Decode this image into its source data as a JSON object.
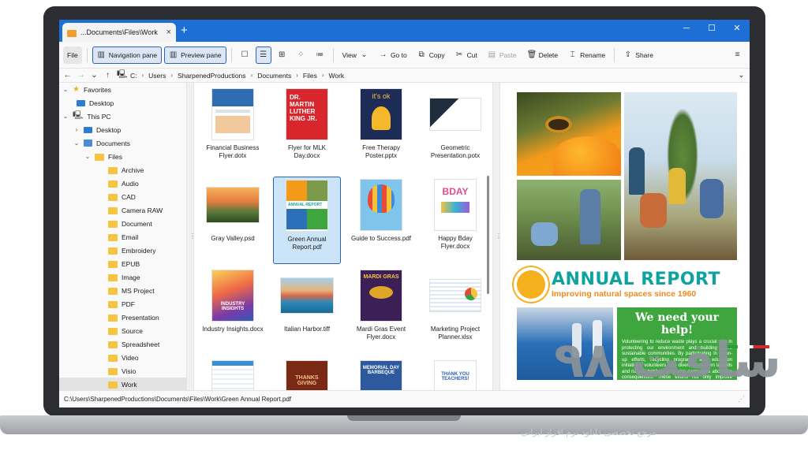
{
  "window": {
    "tab_title": "...Documents\\Files\\Work",
    "new_tab": "+",
    "close_tab": "×",
    "minimize": "─",
    "maximize": "☐",
    "close": "✕"
  },
  "toolbar": {
    "file": "File",
    "navigation_pane": "Navigation pane",
    "preview_pane": "Preview pane",
    "view": "View",
    "go_to": "Go to",
    "copy": "Copy",
    "cut": "Cut",
    "paste": "Paste",
    "delete": "Delete",
    "rename": "Rename",
    "share": "Share"
  },
  "address": {
    "crumbs": [
      "C:",
      "Users",
      "SharpenedProductions",
      "Documents",
      "Files",
      "Work"
    ]
  },
  "sidebar": {
    "favorites": "Favorites",
    "fav_desktop": "Desktop",
    "this_pc": "This PC",
    "desktop": "Desktop",
    "documents": "Documents",
    "files": "Files",
    "folders": [
      "Archive",
      "Audio",
      "CAD",
      "Camera RAW",
      "Document",
      "Email",
      "Embroidery",
      "EPUB",
      "Image",
      "MS Project",
      "PDF",
      "Presentation",
      "Source",
      "Spreadsheet",
      "Video",
      "Visio",
      "Work"
    ]
  },
  "files": [
    {
      "name": "Financial Business Flyer.dotx",
      "thumb": "flyer-blue"
    },
    {
      "name": "Flyer for MLK Day.docx",
      "thumb": "mlk-red"
    },
    {
      "name": "Free Therapy Poster.pptx",
      "thumb": "therapy-navy"
    },
    {
      "name": "Geometric Presentation.potx",
      "thumb": "geometric"
    },
    {
      "name": "Gray Valley.psd",
      "thumb": "valley"
    },
    {
      "name": "Green Annual Report.pdf",
      "thumb": "annual"
    },
    {
      "name": "Guide to Success.pdf",
      "thumb": "balloon"
    },
    {
      "name": "Happy Bday Flyer.docx",
      "thumb": "bday"
    },
    {
      "name": "Industry Insights.docx",
      "thumb": "insights"
    },
    {
      "name": "Italian Harbor.tiff",
      "thumb": "harbor"
    },
    {
      "name": "Mardi Gras Event Flyer.docx",
      "thumb": "mardi"
    },
    {
      "name": "Marketing Project Planner.xlsx",
      "thumb": "planner"
    },
    {
      "name": "",
      "thumb": "sheet"
    },
    {
      "name": "",
      "thumb": "thanks"
    },
    {
      "name": "",
      "thumb": "memorial"
    },
    {
      "name": "",
      "thumb": "teachers"
    }
  ],
  "thumb_text": {
    "mlk": "DR. MARTIN LUTHER KING JR.",
    "therapy": "it's ok",
    "annual": "ANNUAL REPORT",
    "bday": "BDAY",
    "insights": "INDUSTRY INSIGHTS",
    "mardi": "MARDI GRAS",
    "thanks": "THANKS GIVING",
    "memorial": "MEMORIAL DAY BARBEQUE",
    "teachers": "THANK YOU TEACHERS!"
  },
  "preview": {
    "title": "ANNUAL REPORT",
    "subtitle": "Improving natural spaces since 1960",
    "help_title": "We need your help!",
    "help_body": "Volunteering to reduce waste plays a crucial role in protecting our environment and building more sustainable communities. By participating in clean-up efforts, recycling programs, and education initiatives, volunteers help divert waste from landfills and natural habitats and raise awareness about the consequences. These efforts not only improve ecosystems but also inspire local change."
  },
  "status": {
    "path": "C:\\Users\\SharpenedProductions\\Documents\\Files\\Work\\Green Annual Report.pdf"
  },
  "watermark": {
    "logo": "سافت ۹۸",
    "tagline": "مرجع تخصصی دانلود نرم افزار ایرانی"
  }
}
